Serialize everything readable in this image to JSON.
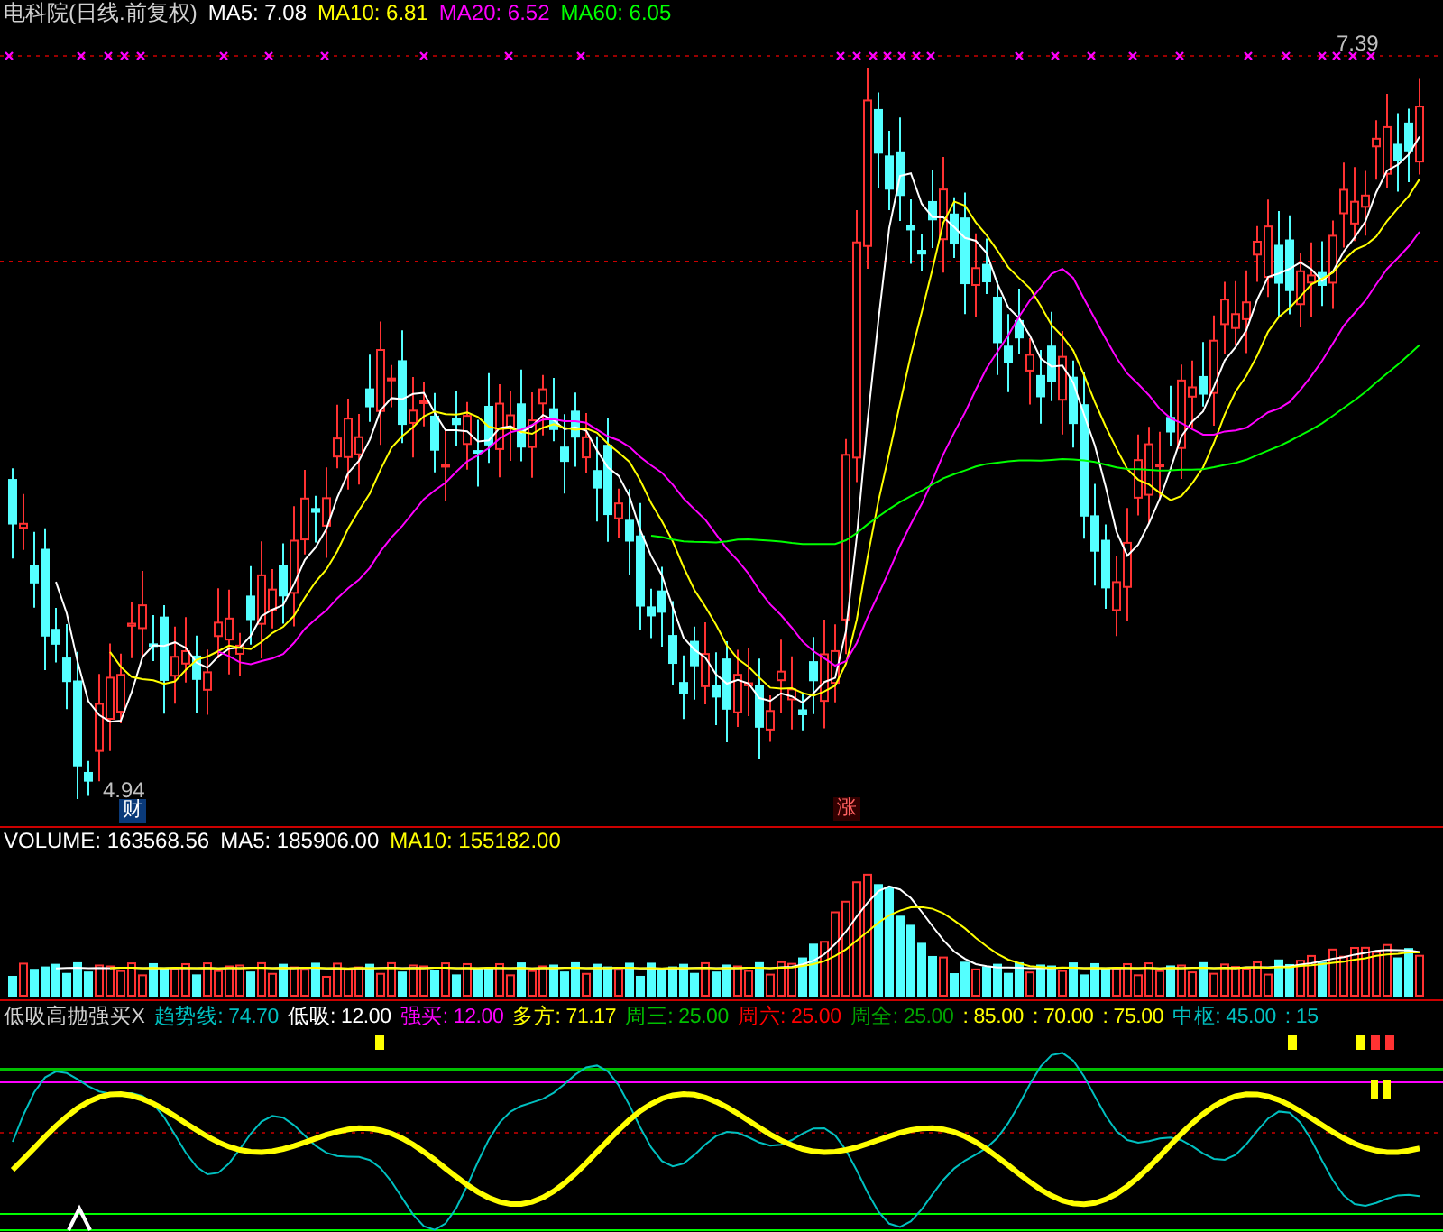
{
  "price_panel": {
    "title": "电科院(日线.前复权)",
    "items": [
      {
        "label": "MA5: 7.08",
        "color": "#ffffff"
      },
      {
        "label": "MA10: 6.81",
        "color": "#ffff00"
      },
      {
        "label": "MA20: 6.52",
        "color": "#ff00ff"
      },
      {
        "label": "MA60: 6.05",
        "color": "#00ff00"
      }
    ],
    "high_label": "7.39",
    "low_label": "4.94",
    "badges": [
      {
        "text": "财",
        "kind": "finance"
      },
      {
        "text": "涨",
        "kind": "limit"
      }
    ]
  },
  "volume_panel": {
    "items": [
      {
        "label": "VOLUME: 163568.56",
        "color": "#ffffff"
      },
      {
        "label": "MA5: 185906.00",
        "color": "#ffffff"
      },
      {
        "label": "MA10: 155182.00",
        "color": "#ffff00"
      }
    ]
  },
  "indicator_panel": {
    "title": "低吸高抛强买X",
    "items": [
      {
        "label": "趋势线: 74.70",
        "color": "#00c0c0"
      },
      {
        "label": "低吸: 12.00",
        "color": "#ffffff"
      },
      {
        "label": "强买: 12.00",
        "color": "#ff00ff"
      },
      {
        "label": "多方: 71.17",
        "color": "#ffff00"
      },
      {
        "label": "周三: 25.00",
        "color": "#00c000"
      },
      {
        "label": "周六: 25.00",
        "color": "#ff0000"
      },
      {
        "label": "周全: 25.00",
        "color": "#00a000"
      },
      {
        "label": ": 85.00",
        "color": "#ffff00"
      },
      {
        "label": ": 70.00",
        "color": "#ffff00"
      },
      {
        "label": ": 75.00",
        "color": "#ffff00"
      },
      {
        "label": "中枢: 45.00",
        "color": "#00c0c0"
      },
      {
        "label": ": 15",
        "color": "#00c0c0"
      }
    ]
  }
}
